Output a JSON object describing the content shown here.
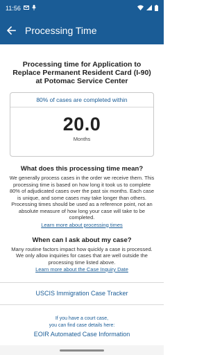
{
  "status_bar": {
    "time": "11:56",
    "left_icons": [
      "mail-icon",
      "microphone-icon"
    ],
    "right_icons": [
      "wifi-icon",
      "signal-icon",
      "battery-icon"
    ]
  },
  "app_bar": {
    "title": "Processing Time",
    "background": "#1a5c96"
  },
  "main": {
    "title": "Processing time for Application to Replace Permanent Resident Card (I-90) at Potomac Service Center",
    "stat_card": {
      "header": "80% of cases are completed within",
      "value": "20.0",
      "unit": "Months"
    },
    "section1": {
      "question": "What does this processing time mean?",
      "body": "We generally process cases in the order we receive them. This processing time is based on how long it took us to complete 80% of adjudicated cases over the past six months. Each case is unique, and some cases may take longer than others. Processing times should be used as a reference point, not an absolute measure of how long your case will take to be completed.",
      "link": "Learn more about processing times"
    },
    "section2": {
      "question": "When can I ask about my case?",
      "body": "Many routine factors impact how quickly a case is processed. We only allow inquiries for cases that are well outside the processing time listed above.",
      "link": "Learn more about the Case Inquiry Date"
    }
  },
  "footer": {
    "tracker_label": "USCIS Immigration Case Tracker",
    "court_note_line1": "If you have a court case,",
    "court_note_line2": "you can find case details here:",
    "eoir_label": "EOIR Automated Case Information"
  },
  "colors": {
    "accent": "#1a5c96"
  }
}
